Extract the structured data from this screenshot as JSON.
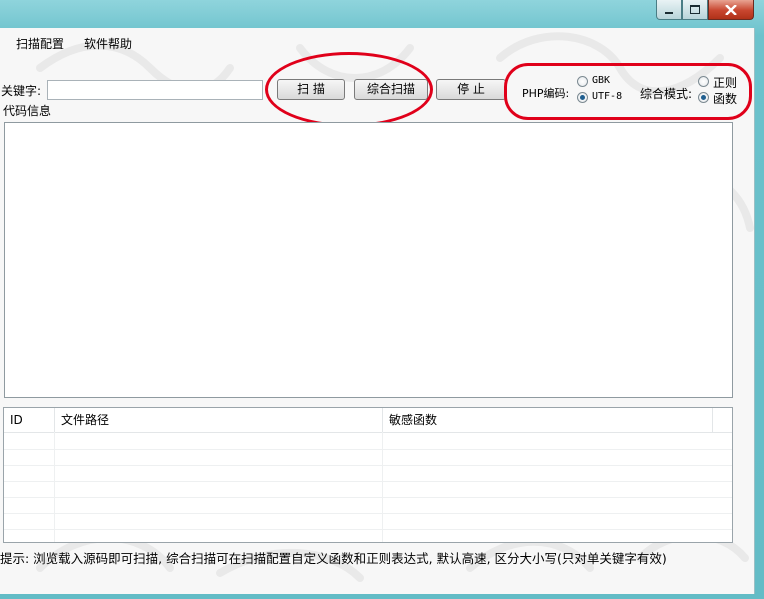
{
  "window": {
    "controls": {
      "minimize_icon": "minimize-icon",
      "maximize_icon": "maximize-icon",
      "close_icon": "close-icon"
    }
  },
  "menu": {
    "items": [
      "扫描配置",
      "软件帮助"
    ]
  },
  "toolbar": {
    "keyword_label": "关键字:",
    "keyword_value": "",
    "scan_label": "扫 描",
    "comprehensive_scan_label": "综合扫描",
    "stop_label": "停 止",
    "php_encoding_label": "PHP编码:",
    "encoding_options": [
      "GBK",
      "UTF-8"
    ],
    "encoding_selected": "UTF-8",
    "mode_label": "综合模式:",
    "mode_options": [
      "正则",
      "函数"
    ],
    "mode_selected": "函数"
  },
  "code_info_label": "代码信息",
  "code_info_value": "",
  "results_table": {
    "columns": [
      "ID",
      "文件路径",
      "敏感函数"
    ],
    "rows": []
  },
  "status": {
    "hint": "提示: 浏览载入源码即可扫描, 综合扫描可在扫描配置自定义函数和正则表达式, 默认高速, 区分大小写(只对单关键字有效)"
  },
  "colors": {
    "annotation": "#e0001a",
    "titlebar": "#63bcc6"
  }
}
